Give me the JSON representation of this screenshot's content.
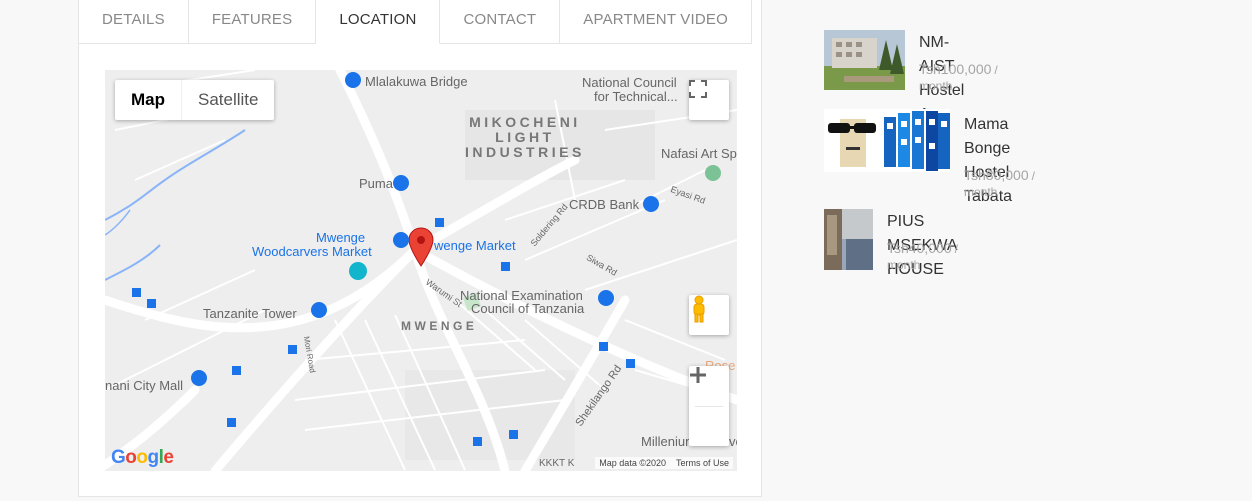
{
  "tabs": [
    "DETAILS",
    "FEATURES",
    "LOCATION",
    "CONTACT",
    "APARTMENT VIDEO"
  ],
  "active_tab": "LOCATION",
  "map": {
    "type_map": "Map",
    "type_satellite": "Satellite",
    "labels": {
      "mlalakuwa": "Mlalakuwa Bridge",
      "national_council_1": "National Council",
      "national_council_2": "for Technical...",
      "mikocheni_1": "MIKOCHENI",
      "mikocheni_2": "LIGHT",
      "mikocheni_3": "INDUSTRIES",
      "nafasi": "Nafasi Art Sp",
      "puma": "Puma",
      "crdb": "CRDB Bank",
      "eyasi": "Eyasi Rd",
      "mwenge_woodcarvers_1": "Mwenge",
      "mwenge_woodcarvers_2": "Woodcarvers Market",
      "mwenge_market": "wenge Market",
      "soldering": "Soldering Rd",
      "siwa": "Siwa Rd",
      "necta_1": "National Examination",
      "necta_2": "Council of Tanzania",
      "warumi": "Warumi St",
      "tanzanite": "Tanzanite Tower",
      "mwenge_area": "MWENGE",
      "nani_city": "nani City Mall",
      "shekilango": "Shekilango Rd",
      "rose": "Rose G",
      "millenium": "Millenium",
      "millenium_suffix": "ve",
      "kkkt": "KKKT K",
      "mori": "Mori Road"
    },
    "google": "Google",
    "attribution": "Map data ©2020",
    "terms": "Terms of Use"
  },
  "listings": [
    {
      "title": "NM-AIST Hostel A",
      "price": "Tsh100,000",
      "unit": "/ month"
    },
    {
      "title_line1": "Mama Bonge Hostel",
      "title_line2": "Tabata",
      "price": "Tsh80,000",
      "unit": "/ month"
    },
    {
      "title": "PIUS MSEKWA HOUSE",
      "price": "Tsh40,000",
      "unit": "/ month"
    }
  ],
  "colors": {
    "map_bg": "#eeeeee",
    "road": "#ffffff",
    "water": "#8ab4f8",
    "pin": "#ea4335",
    "poi_blue": "#1a73e8",
    "price": "#a5a5a5"
  }
}
